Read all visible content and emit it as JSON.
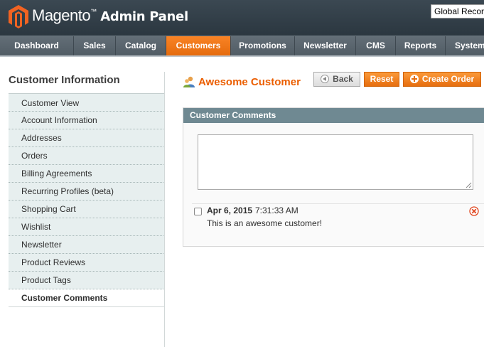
{
  "header": {
    "logo_text": "Magento",
    "logo_tm": "™",
    "logo_sub": "Admin Panel",
    "scope_value": "Global Record Search"
  },
  "nav": {
    "items": [
      {
        "label": "Dashboard"
      },
      {
        "label": "Sales"
      },
      {
        "label": "Catalog"
      },
      {
        "label": "Customers"
      },
      {
        "label": "Promotions"
      },
      {
        "label": "Newsletter"
      },
      {
        "label": "CMS"
      },
      {
        "label": "Reports"
      },
      {
        "label": "System"
      }
    ],
    "active": "Customers"
  },
  "sidebar": {
    "title": "Customer Information",
    "items": [
      {
        "label": "Customer View"
      },
      {
        "label": "Account Information"
      },
      {
        "label": "Addresses"
      },
      {
        "label": "Orders"
      },
      {
        "label": "Billing Agreements"
      },
      {
        "label": "Recurring Profiles (beta)"
      },
      {
        "label": "Shopping Cart"
      },
      {
        "label": "Wishlist"
      },
      {
        "label": "Newsletter"
      },
      {
        "label": "Product Reviews"
      },
      {
        "label": "Product Tags"
      },
      {
        "label": "Customer Comments"
      }
    ],
    "active": "Customer Comments"
  },
  "main": {
    "customer_name": "Awesome Customer",
    "buttons": {
      "back": "Back",
      "reset": "Reset",
      "create_order": "Create Order"
    },
    "comments_section": {
      "title": "Customer Comments",
      "textarea_value": "",
      "comments": [
        {
          "date": "Apr 6, 2015",
          "time": "7:31:33 AM",
          "text": "This is an awesome customer!"
        }
      ]
    }
  },
  "colors": {
    "accent_orange": "#eb5e00",
    "header_bg": "#2f3b44",
    "section_head": "#6f8992",
    "sidebar_bg": "#e7efef"
  }
}
